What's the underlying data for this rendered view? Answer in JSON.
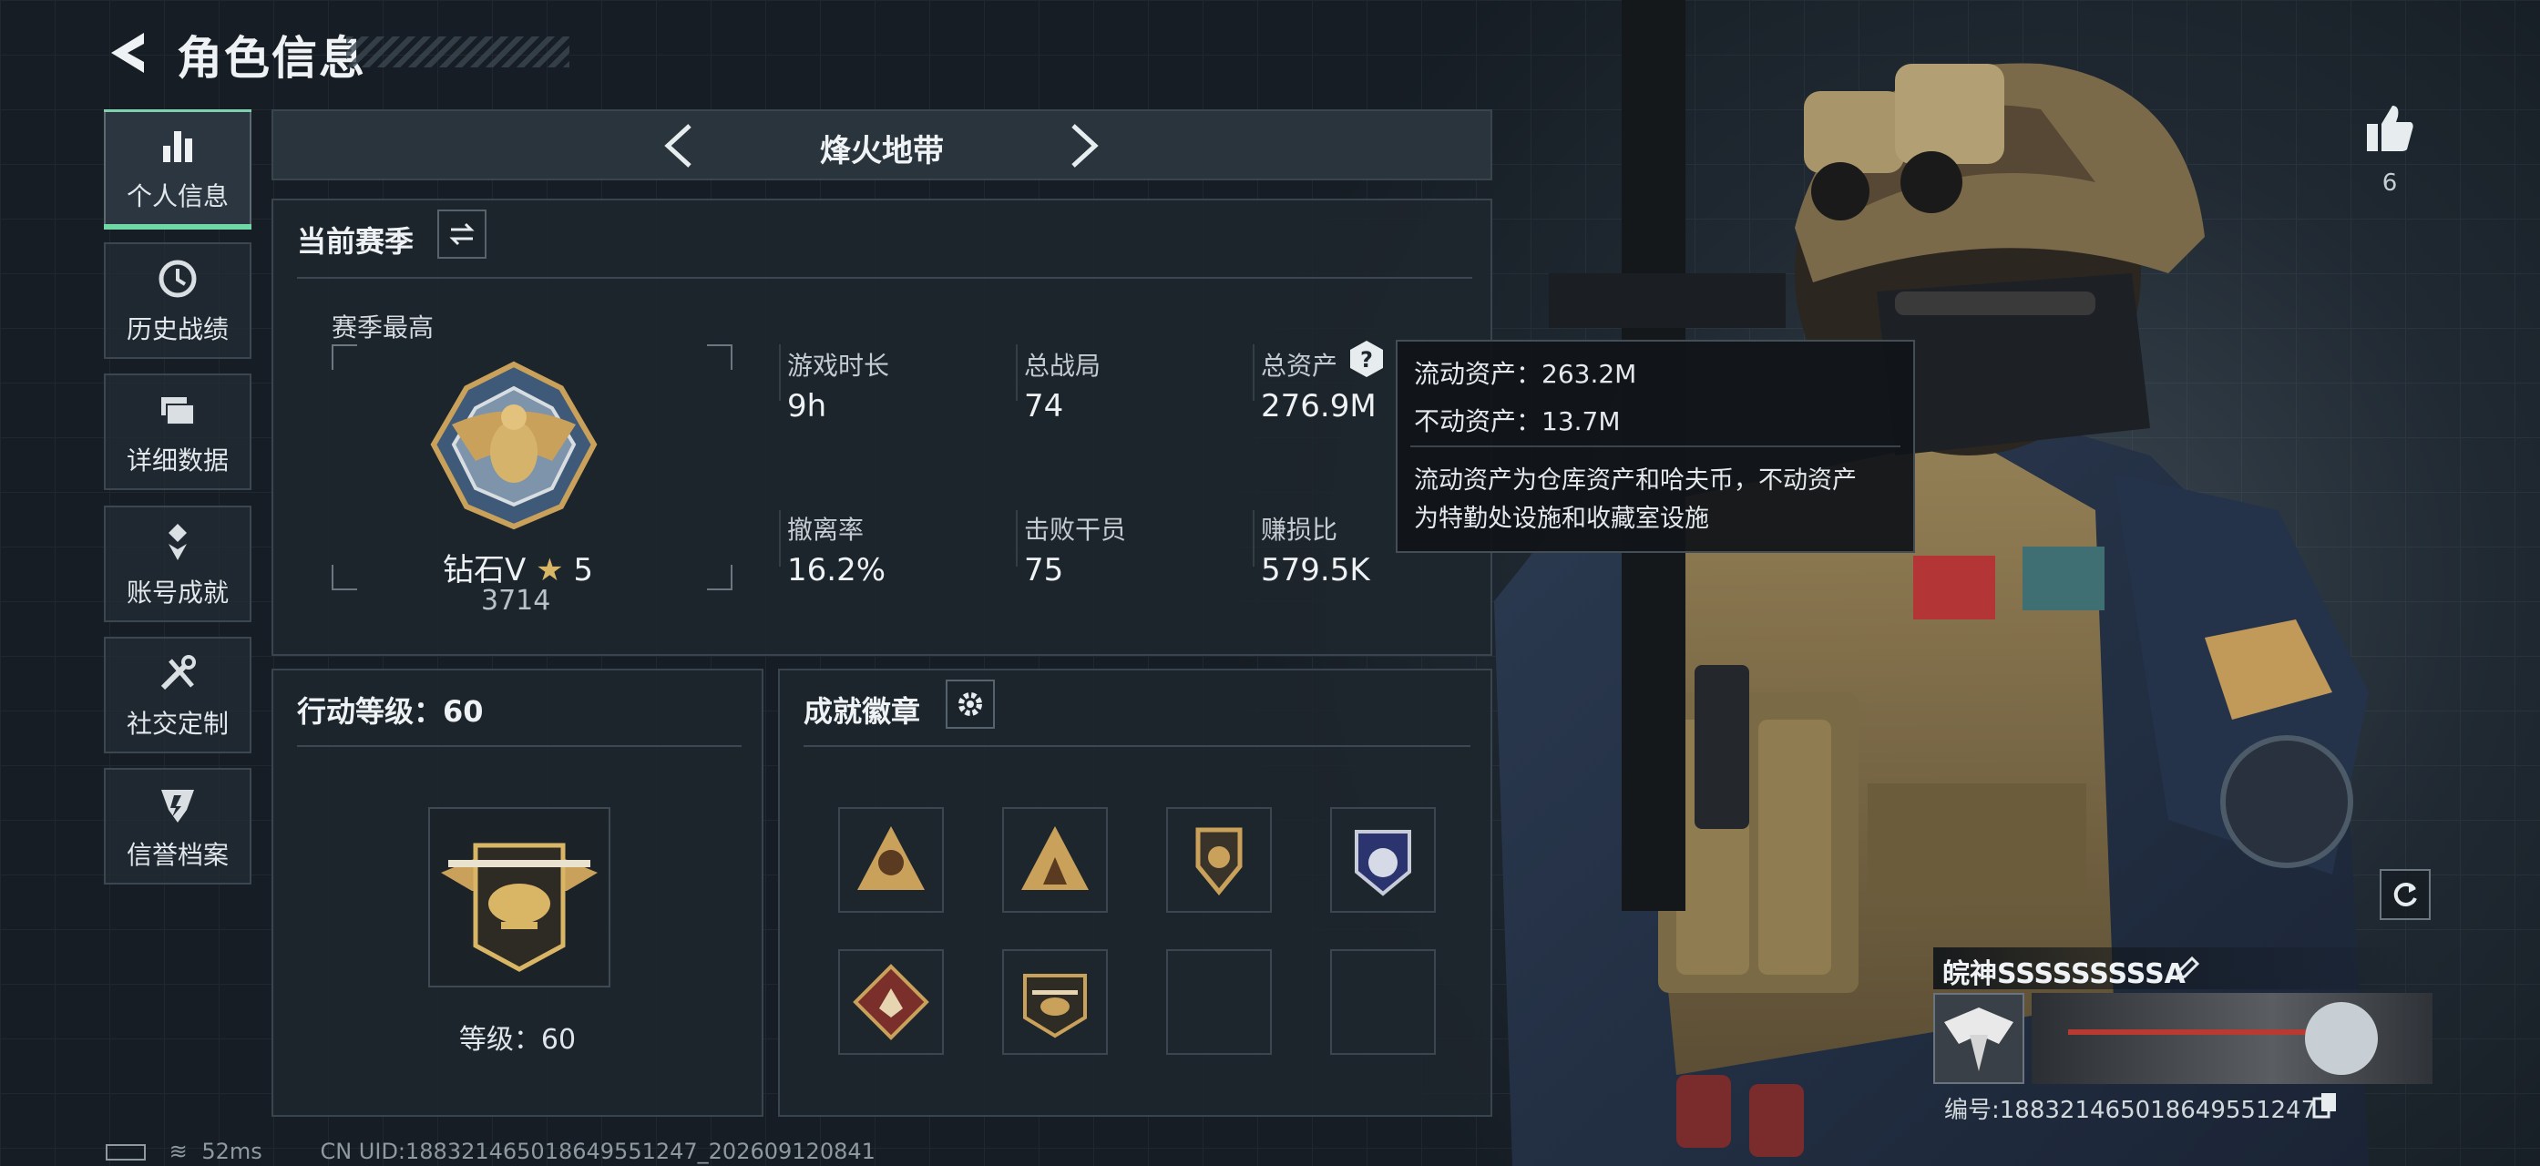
{
  "header": {
    "title": "角色信息"
  },
  "sidebar": {
    "items": [
      {
        "label": "个人信息",
        "icon": "bar-chart-icon",
        "active": true
      },
      {
        "label": "历史战绩",
        "icon": "history-clock-icon"
      },
      {
        "label": "详细数据",
        "icon": "data-folder-icon"
      },
      {
        "label": "账号成就",
        "icon": "achievement-icon"
      },
      {
        "label": "社交定制",
        "icon": "tools-icon"
      },
      {
        "label": "信誉档案",
        "icon": "credit-emblem-icon"
      }
    ]
  },
  "mode": {
    "title": "烽火地带"
  },
  "season": {
    "title": "当前赛季",
    "best_label": "赛季最高",
    "rank_name": "钻石V",
    "rank_stars": "5",
    "rank_score": "3714",
    "stats": [
      {
        "label": "游戏时长",
        "value": "9h"
      },
      {
        "label": "总战局",
        "value": "74"
      },
      {
        "label": "总资产",
        "value": "276.9M"
      },
      {
        "label": "撤离率",
        "value": "16.2%"
      },
      {
        "label": "击败干员",
        "value": "75"
      },
      {
        "label": "赚损比",
        "value": "579.5K"
      }
    ]
  },
  "tooltip": {
    "liquid": "流动资产：263.2M",
    "fixed": "不动资产：13.7M",
    "desc_line1": "流动资产为仓库资产和哈夫币，不动资产",
    "desc_line2": "为特勤处设施和收藏室设施"
  },
  "action_level": {
    "title": "行动等级：60",
    "level_text": "等级：60"
  },
  "achievements": {
    "title": "成就徽章",
    "filled_badges": 6,
    "total_slots": 8
  },
  "likes": {
    "count": "6"
  },
  "player": {
    "name": "皖神SSSSSSSSSA",
    "id_text": "编号:1883214650186495​51247"
  },
  "statusbar": {
    "ping": "52ms",
    "uid": "CN UID:18832146501864955​1247_202609120841"
  },
  "colors": {
    "accent_green": "#6fd6a6",
    "background": "#1b232b",
    "gold": "#c9a15a"
  }
}
